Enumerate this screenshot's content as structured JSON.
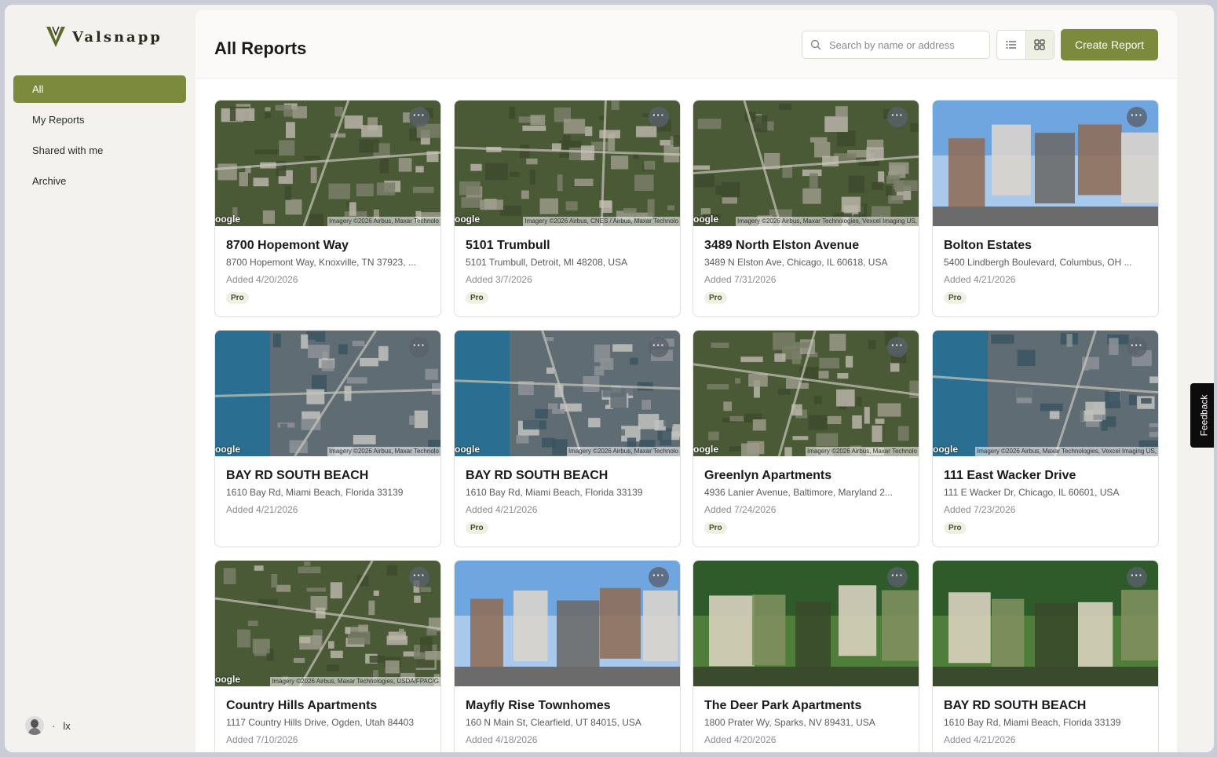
{
  "brand": {
    "name": "Valsnapp",
    "accent": "#7b8a3c"
  },
  "sidebar": {
    "items": [
      {
        "label": "All",
        "active": true
      },
      {
        "label": "My Reports"
      },
      {
        "label": "Shared with me"
      },
      {
        "label": "Archive"
      }
    ],
    "user": {
      "name": "lx",
      "separator": "·"
    }
  },
  "header": {
    "title": "All Reports",
    "search_placeholder": "Search by name or address",
    "view_modes": [
      "list-icon",
      "grid-icon"
    ],
    "active_view": "grid",
    "create_label": "Create Report"
  },
  "feedback_label": "Feedback",
  "cards": [
    {
      "title": "8700 Hopemont Way",
      "address": "8700 Hopemont Way, Knoxville, TN 37923, ...",
      "date": "Added 4/20/2026",
      "badge": "Pro",
      "image": "aerial",
      "credit": "Imagery ©2026 Airbus, Maxar Technolo"
    },
    {
      "title": "5101 Trumbull",
      "address": "5101 Trumbull, Detroit, MI 48208, USA",
      "date": "Added 3/7/2026",
      "badge": "Pro",
      "image": "aerial",
      "credit": "Imagery ©2026 Airbus, CNES / Airbus, Maxar Technolo"
    },
    {
      "title": "3489 North Elston Avenue",
      "address": "3489 N Elston Ave, Chicago, IL 60618, USA",
      "date": "Added 7/31/2026",
      "badge": "Pro",
      "image": "aerial",
      "credit": "Imagery ©2026 Airbus, Maxar Technologies, Vexcel Imaging US,"
    },
    {
      "title": "Bolton Estates",
      "address": "5400 Lindbergh Boulevard, Columbus, OH ...",
      "date": "Added 4/21/2026",
      "badge": "Pro",
      "image": "photo"
    },
    {
      "title": "BAY RD SOUTH BEACH",
      "address": "1610 Bay Rd, Miami Beach, Florida 33139",
      "date": "Added 4/21/2026",
      "badge": "",
      "image": "aerial-water",
      "credit": "Imagery ©2026 Airbus, Maxar Technolo"
    },
    {
      "title": "BAY RD SOUTH BEACH",
      "address": "1610 Bay Rd, Miami Beach, Florida 33139",
      "date": "Added 4/21/2026",
      "badge": "Pro",
      "image": "aerial-water",
      "credit": "Imagery ©2026 Airbus, Maxar Technolo"
    },
    {
      "title": "Greenlyn Apartments",
      "address": "4936 Lanier Avenue, Baltimore, Maryland 2...",
      "date": "Added 7/24/2026",
      "badge": "Pro",
      "image": "aerial",
      "credit": "Imagery ©2026 Airbus, Maxar Technolo"
    },
    {
      "title": "111 East Wacker Drive",
      "address": "111 E Wacker Dr, Chicago, IL 60601, USA",
      "date": "Added 7/23/2026",
      "badge": "Pro",
      "image": "aerial-water",
      "credit": "Imagery ©2026 Airbus, Maxar Technologies, Vexcel Imaging US,"
    },
    {
      "title": "Country Hills Apartments",
      "address": "1117 Country Hills Drive, Ogden, Utah 84403",
      "date": "Added 7/10/2026",
      "badge": "",
      "image": "aerial",
      "credit": "Imagery ©2026 Airbus, Maxar Technologies, USDA/FPAC/G"
    },
    {
      "title": "Mayfly Rise Townhomes",
      "address": "160 N Main St, Clearfield, UT 84015, USA",
      "date": "Added 4/18/2026",
      "badge": "",
      "image": "photo"
    },
    {
      "title": "The Deer Park Apartments",
      "address": "1800 Prater Wy, Sparks, NV 89431, USA",
      "date": "Added 4/20/2026",
      "badge": "",
      "image": "photo-green"
    },
    {
      "title": "BAY RD SOUTH BEACH",
      "address": "1610 Bay Rd, Miami Beach, Florida 33139",
      "date": "Added 4/21/2026",
      "badge": "",
      "image": "photo-green"
    }
  ],
  "map_watermark": "oogle"
}
